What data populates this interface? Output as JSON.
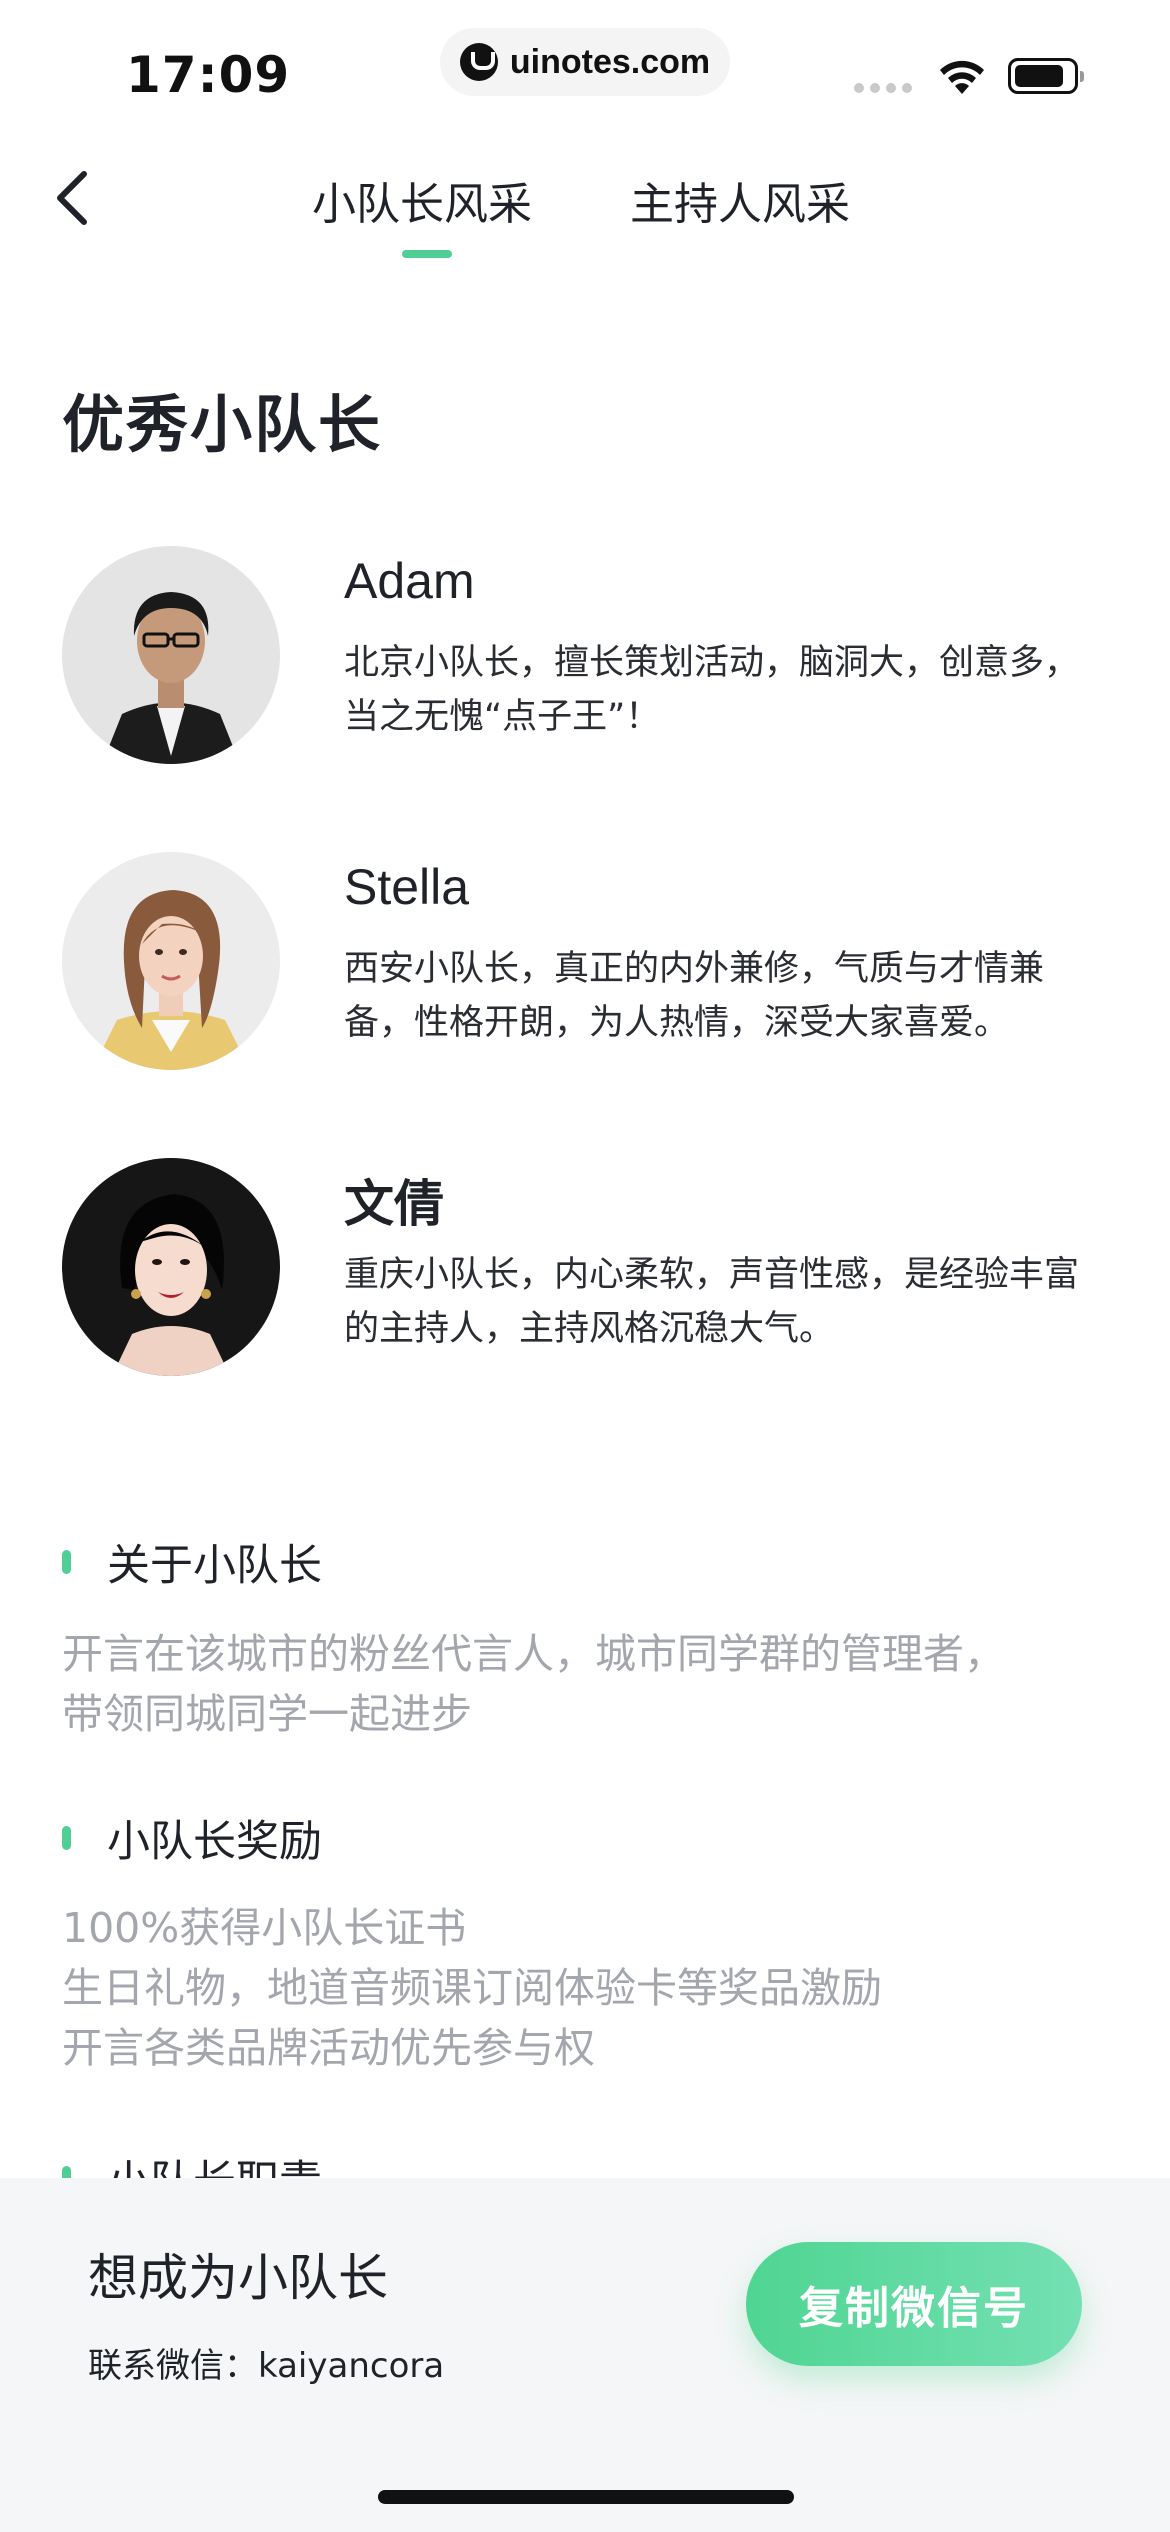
{
  "status_bar": {
    "time": "17:09",
    "url": "uinotes.com"
  },
  "nav": {
    "tabs": [
      {
        "label": "小队长风采",
        "active": true
      },
      {
        "label": "主持人风采",
        "active": false
      }
    ],
    "accent_color": "#4fcf94"
  },
  "main": {
    "title": "优秀小队长",
    "leaders": [
      {
        "name": "Adam",
        "desc": "北京小队长，擅长策划活动，脑洞大，创意多，当之无愧“点子王”！"
      },
      {
        "name": "Stella",
        "desc": "西安小队长，真正的内外兼修，气质与才情兼备，性格开朗，为人热情，深受大家喜爱。"
      },
      {
        "name": "文倩",
        "desc": "重庆小队长，内心柔软，声音性感，是经验丰富的主持人，主持风格沉稳大气。"
      }
    ],
    "sections": [
      {
        "title": "关于小队长",
        "lines": [
          "开言在该城市的粉丝代言人，城市同学群的管理者，",
          "带领同城同学一起进步"
        ]
      },
      {
        "title": "小队长奖励",
        "lines": [
          "100%获得小队长证书",
          "生日礼物，地道音频课订阅体验卡等奖品激励",
          "开言各类品牌活动优先参与权"
        ]
      },
      {
        "title": "小队长职责",
        "lines": []
      }
    ]
  },
  "bottom": {
    "title": "想成为小队长",
    "contact": "联系微信：kaiyancora",
    "button_label": "复制微信号"
  }
}
